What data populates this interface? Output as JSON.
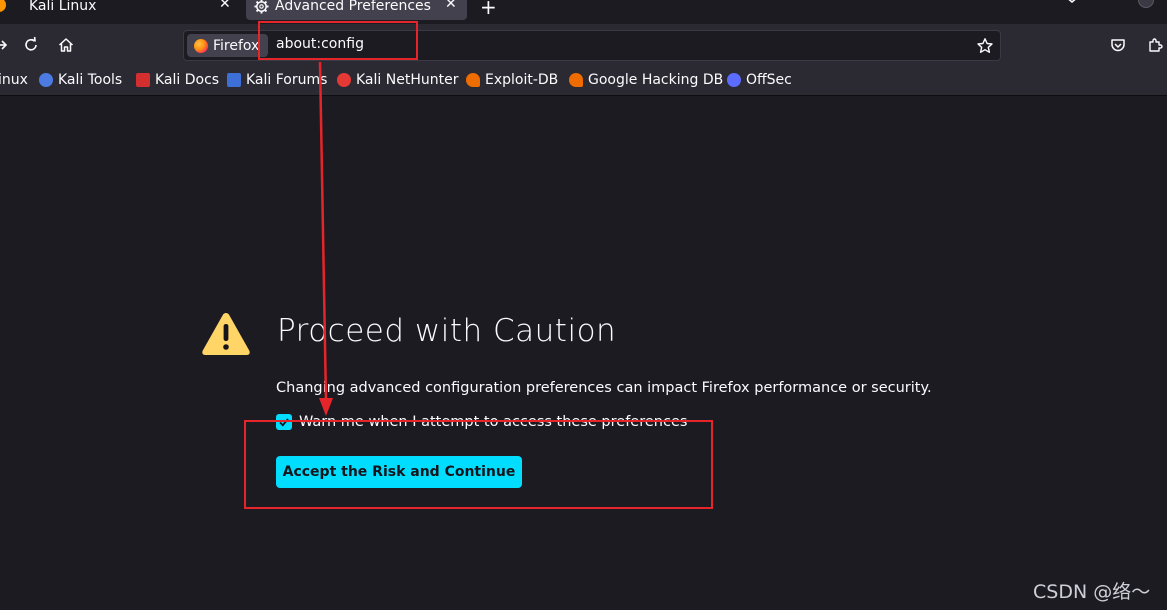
{
  "tabs": [
    {
      "label": "Kali Linux",
      "close": "✕"
    },
    {
      "label": "Advanced Preferences",
      "close": "✕"
    }
  ],
  "new_tab_glyph": "+",
  "navbar": {
    "identity_label": "Firefox",
    "url": "about:config",
    "icons": [
      "reload-icon",
      "home-icon",
      "bookmark-star-icon",
      "pocket-icon",
      "extensions-icon"
    ]
  },
  "bookmarks": [
    {
      "label": "inux",
      "icon": "kali-icon",
      "color": "#367bf0"
    },
    {
      "label": "Kali Tools",
      "icon": "kali-tools-icon",
      "color": "#4c7ce3"
    },
    {
      "label": "Kali Docs",
      "icon": "kali-docs-icon",
      "color": "#d32f2f"
    },
    {
      "label": "Kali Forums",
      "icon": "kali-forums-icon",
      "color": "#3d6fd6"
    },
    {
      "label": "Kali NetHunter",
      "icon": "nethunter-icon",
      "color": "#e53935"
    },
    {
      "label": "Exploit-DB",
      "icon": "exploit-db-icon",
      "color": "#ef6c00"
    },
    {
      "label": "Google Hacking DB",
      "icon": "ghdb-icon",
      "color": "#ef6c00"
    },
    {
      "label": "OffSec",
      "icon": "offsec-icon",
      "color": "#5b6cff"
    }
  ],
  "page": {
    "heading": "Proceed with Caution",
    "description": "Changing advanced configuration preferences can impact Firefox performance or security.",
    "checkbox_label": "Warn me when I attempt to access these preferences",
    "checkbox_checked": true,
    "accept_button": "Accept the Risk and Continue"
  },
  "colors": {
    "accent": "#00ddff",
    "warning": "#ffd567",
    "annotation": "#e5252a"
  },
  "watermark": "CSDN @络～"
}
